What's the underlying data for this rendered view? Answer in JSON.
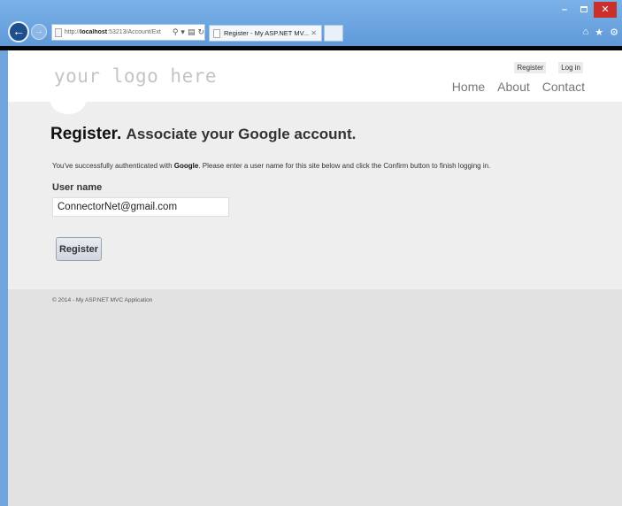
{
  "browser": {
    "url_prefix": "http://",
    "url_host": "localhost",
    "url_rest": ":53213/Account/Ext",
    "tab_title": "Register - My ASP.NET MV...",
    "icons": [
      "back-icon",
      "forward-icon",
      "search-icon",
      "compat-icon",
      "refresh-icon",
      "home-icon",
      "star-icon",
      "gear-icon"
    ]
  },
  "header": {
    "logo": "your logo here",
    "login_links": [
      "Register",
      "Log in"
    ],
    "nav": [
      "Home",
      "About",
      "Contact"
    ]
  },
  "main": {
    "title": "Register.",
    "subtitle": "Associate your Google account.",
    "info_before": "You've successfully authenticated with ",
    "info_provider": "Google",
    "info_after": ". Please enter a user name for this site below and click the Confirm button to finish logging in.",
    "user_name_label": "User name",
    "user_name_value": "ConnectorNet@gmail.com",
    "register_button": "Register"
  },
  "footer": {
    "copyright": "© 2014 - My ASP.NET MVC Application"
  }
}
